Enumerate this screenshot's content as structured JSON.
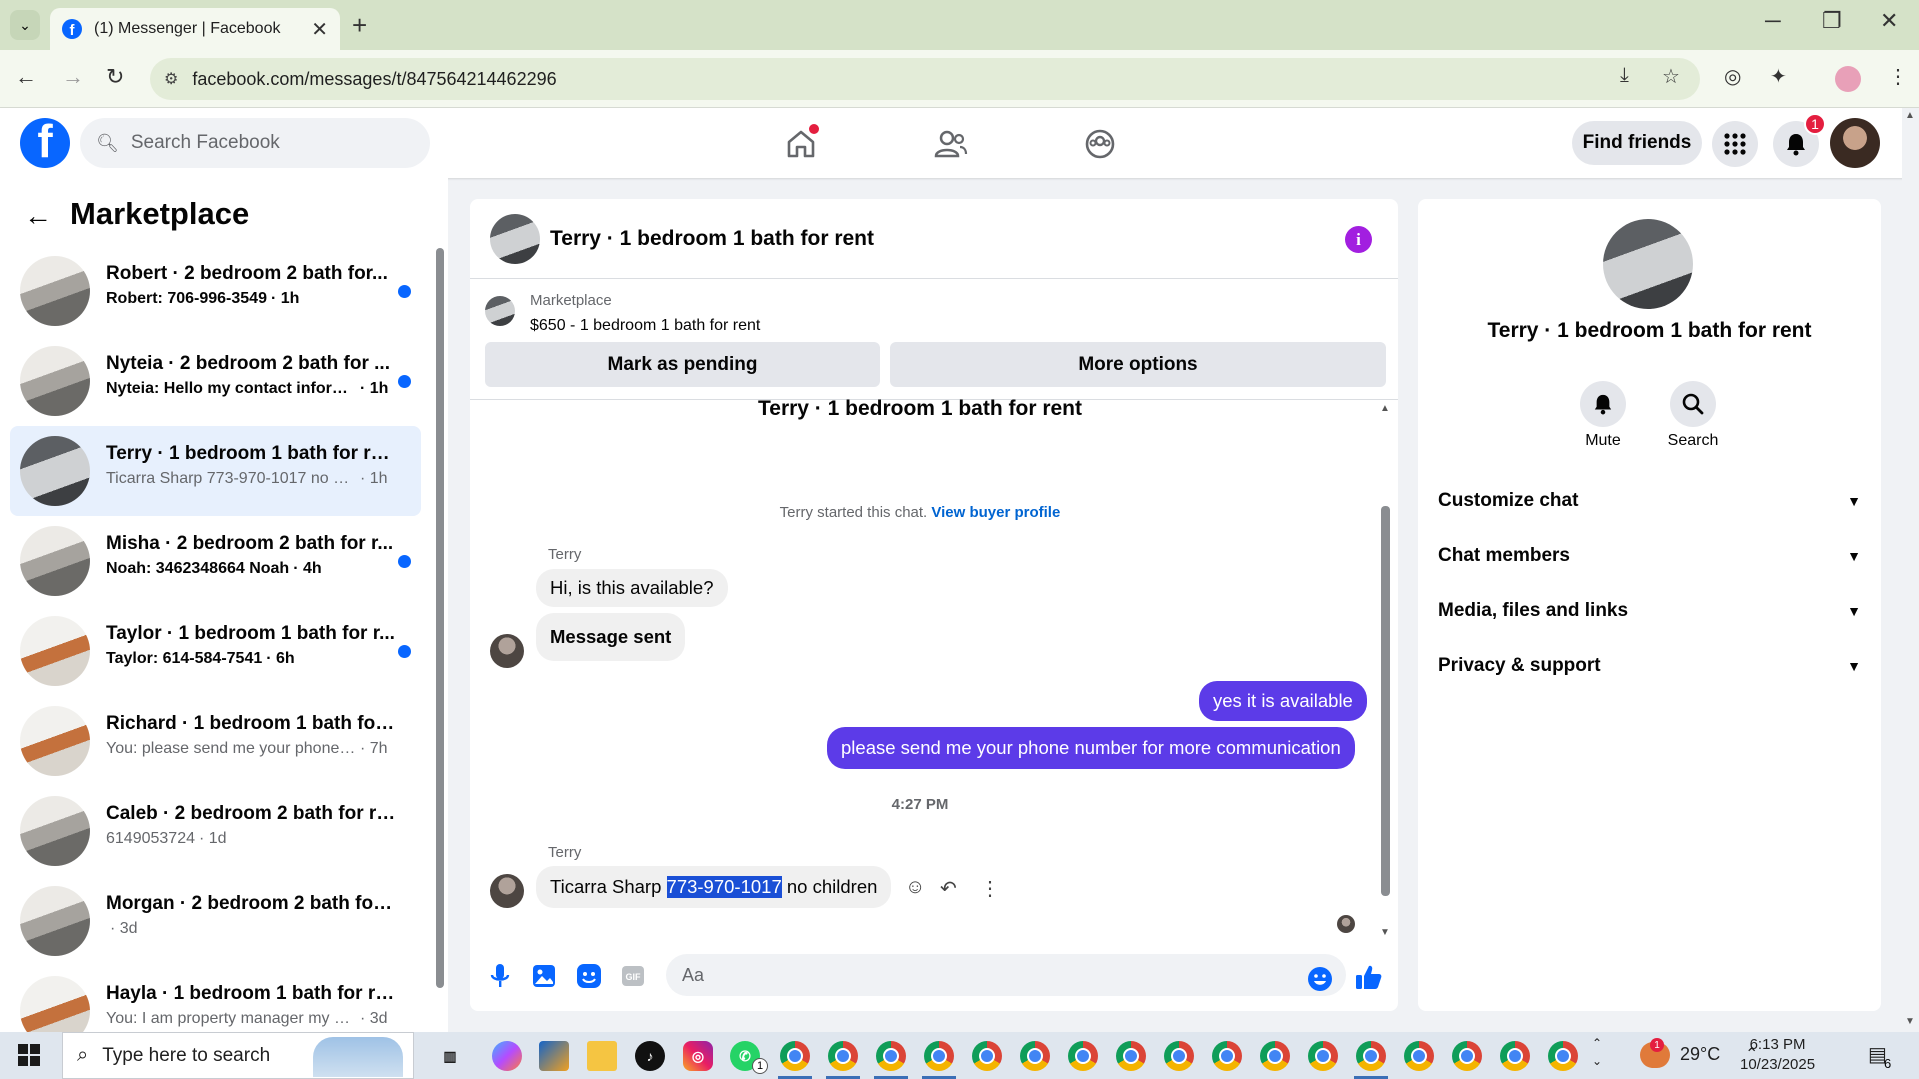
{
  "browser": {
    "tab_title": "(1) Messenger | Facebook",
    "url": "facebook.com/messages/t/847564214462296"
  },
  "fb": {
    "search_placeholder": "Search Facebook",
    "find_friends": "Find friends",
    "notification_count": "1"
  },
  "left": {
    "title": "Marketplace",
    "conversations": [
      {
        "name": "Robert · 2 bedroom 2 bath for...",
        "preview": "Robert: 706-996-3549",
        "time": "· 1h",
        "unread": true,
        "thumb": "a"
      },
      {
        "name": "Nyteia · 2 bedroom 2 bath for ...",
        "preview": "Nyteia: Hello my contact inform...",
        "time": "· 1h",
        "unread": true,
        "thumb": "a"
      },
      {
        "name": "Terry · 1 bedroom 1 bath for rent",
        "preview": "Ticarra Sharp 773-970-1017 no chil...",
        "time": "· 1h",
        "unread": false,
        "thumb": "c"
      },
      {
        "name": "Misha · 2 bedroom 2 bath for r...",
        "preview": "Noah: 3462348664 Noah",
        "time": "· 4h",
        "unread": true,
        "thumb": "a"
      },
      {
        "name": "Taylor · 1 bedroom 1 bath for r...",
        "preview": "Taylor: 614-584-7541",
        "time": "· 6h",
        "unread": true,
        "thumb": "b"
      },
      {
        "name": "Richard · 1 bedroom 1 bath for r...",
        "preview": "You: please send me your phone n...",
        "time": "· 7h",
        "unread": false,
        "thumb": "b"
      },
      {
        "name": "Caleb · 2 bedroom 2 bath for rent",
        "preview": "6149053724",
        "time": "· 1d",
        "unread": false,
        "thumb": "a"
      },
      {
        "name": "Morgan · 2 bedroom 2 bath for ...",
        "preview": "",
        "time": "· 3d",
        "unread": false,
        "thumb": "a"
      },
      {
        "name": "Hayla · 1 bedroom 1 bath for rent",
        "preview": "You: I am property manager my ow...",
        "time": "· 3d",
        "unread": false,
        "thumb": "b"
      }
    ]
  },
  "chat": {
    "title": "Terry · 1 bedroom 1 bath for rent",
    "listing_source": "Marketplace",
    "listing": "$650 - 1 bedroom 1 bath for rent",
    "mark_pending": "Mark as pending",
    "more_options": "More options",
    "conversation_title": "Terry · 1 bedroom 1 bath for rent",
    "started_text": "Terry started this chat.",
    "buyer_profile_link": "View buyer profile",
    "sender_name": "Terry",
    "msg1": "Hi, is this available?",
    "msg2": "Message sent",
    "out1": "yes it is available",
    "out2": "please send me your phone number for more communication",
    "timestamp": "4:27 PM",
    "last_msg_before": "Ticarra Sharp ",
    "last_msg_highlight": "773-970-1017",
    "last_msg_after": " no children",
    "composer_placeholder": "Aa"
  },
  "right": {
    "title": "Terry · 1 bedroom 1 bath for rent",
    "mute": "Mute",
    "search": "Search",
    "sections": [
      "Customize chat",
      "Chat members",
      "Media, files and links",
      "Privacy & support"
    ]
  },
  "taskbar": {
    "search_placeholder": "Type here to search",
    "weather": "29°C",
    "weather_badge": "1",
    "time": "6:13 PM",
    "date": "10/23/2025",
    "notif_count": "6",
    "whatsapp_badge": "1"
  },
  "colors": {
    "fb_blue": "#0866ff",
    "outgoing_bubble": "#5c3be8",
    "info_purple": "#a21fe0",
    "unread_dot": "#0866ff"
  }
}
